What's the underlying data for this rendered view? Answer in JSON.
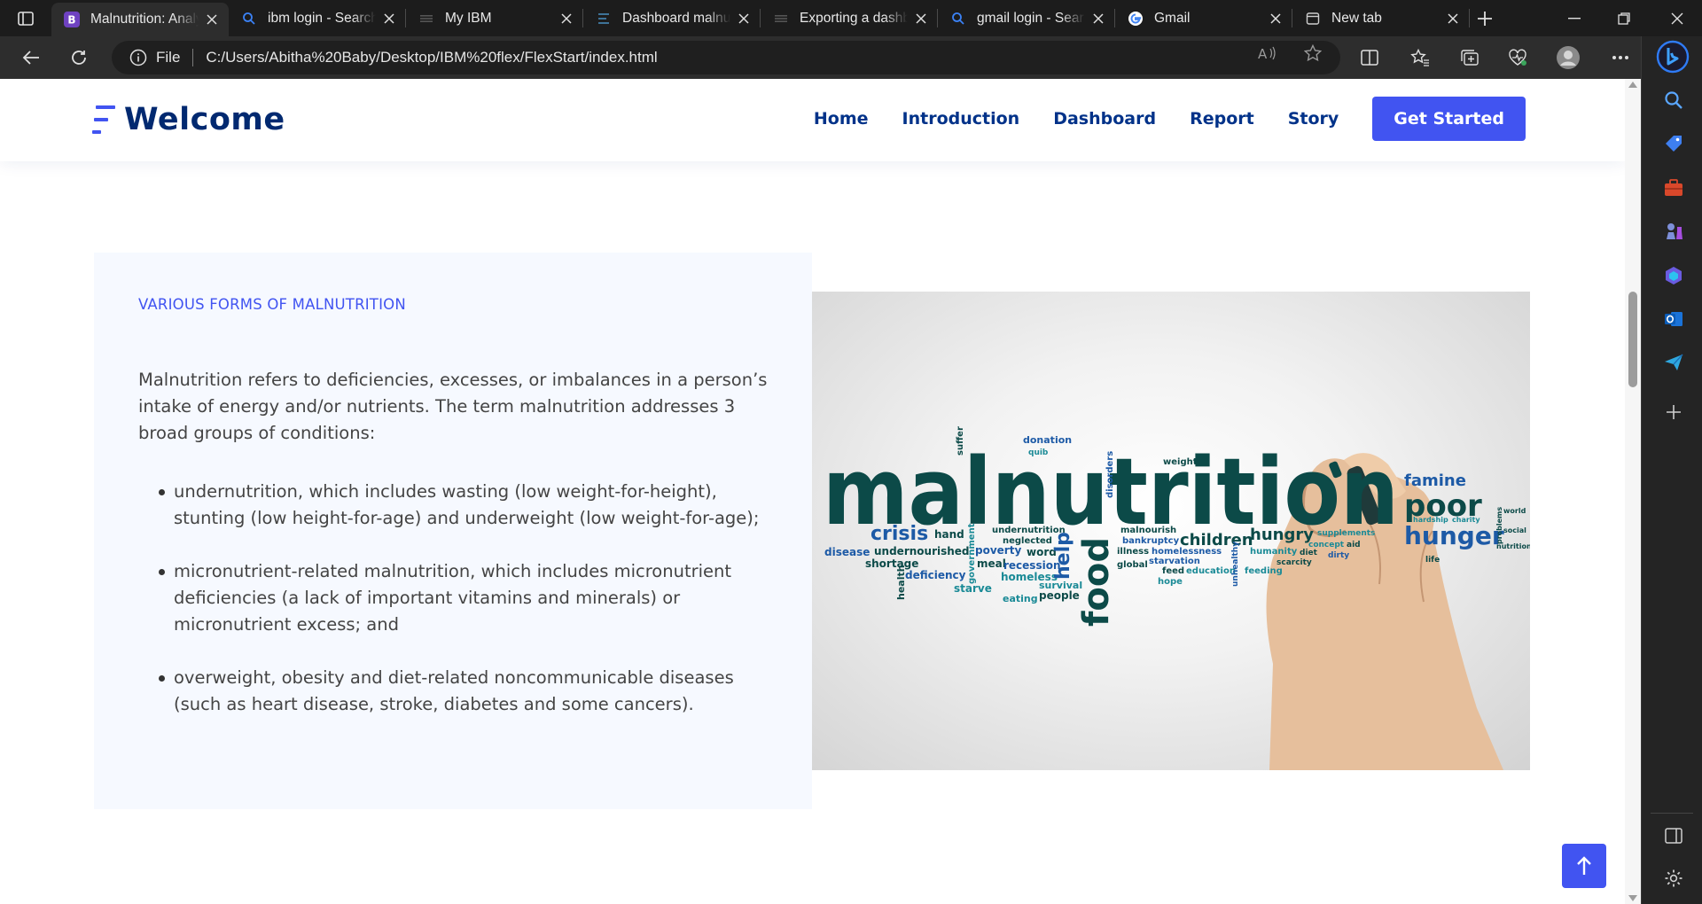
{
  "browser": {
    "tabs": [
      {
        "title": "Malnutrition: Analy",
        "icon": "bootstrap-favicon",
        "active": true
      },
      {
        "title": "ibm login - Search",
        "icon": "search-favicon",
        "active": false
      },
      {
        "title": "My IBM",
        "icon": "ibm-favicon",
        "active": false
      },
      {
        "title": "Dashboard malnu",
        "icon": "dashboard-favicon",
        "active": false
      },
      {
        "title": "Exporting a dashb",
        "icon": "ibm-favicon",
        "active": false
      },
      {
        "title": "gmail login - Sear",
        "icon": "search-favicon",
        "active": false
      },
      {
        "title": "Gmail",
        "icon": "google-favicon",
        "active": false
      },
      {
        "title": "New tab",
        "icon": "newtab-favicon",
        "active": false
      }
    ],
    "address": {
      "scheme_label": "File",
      "url": "C:/Users/Abitha%20Baby/Desktop/IBM%20flex/FlexStart/index.html"
    },
    "colors": {
      "chrome_dark": "#1c1c1c",
      "toolbar": "#2d2d2d"
    }
  },
  "site": {
    "logo_text": "Welcome",
    "nav": {
      "home": "Home",
      "introduction": "Introduction",
      "dashboard": "Dashboard",
      "report": "Report",
      "story": "Story",
      "cta": "Get Started"
    },
    "colors": {
      "primary": "#4154f1",
      "heading": "#012970",
      "nav": "#013289",
      "text": "#444444",
      "panel": "#f6f9ff"
    }
  },
  "section": {
    "subtitle": "VARIOUS FORMS OF MALNUTRITION",
    "intro": "Malnutrition refers to deficiencies, excesses, or imbalances in a person’s intake of energy and/or nutrients. The term malnutrition addresses 3 broad groups of conditions:",
    "bullets": [
      "undernutrition, which includes wasting (low weight-for-height), stunting (low height-for-age) and underweight (low weight-for-age);",
      "micronutrient-related malnutrition, which includes micronutrient deficiencies (a lack of important vitamins and minerals) or micronutrient excess; and",
      "overweight, obesity and diet-related noncommunicable diseases (such as heart disease, stroke, diabetes and some cancers)."
    ]
  },
  "word_cloud": {
    "main": "malnutrition",
    "words": [
      "suffer",
      "donation",
      "quib",
      "weight",
      "disorders",
      "famine",
      "poor",
      "crisis",
      "hand",
      "undernutrition",
      "neglected",
      "malnourish",
      "bankruptcy",
      "children",
      "hungry",
      "supplements",
      "concept",
      "aid",
      "hunger",
      "problems",
      "world",
      "social",
      "nutrition",
      "disease",
      "undernourished",
      "shortage",
      "government",
      "poverty",
      "word",
      "meal",
      "recession",
      "homeless",
      "illness",
      "homelessness",
      "starvation",
      "feed",
      "education",
      "humanity",
      "scarcity",
      "feeding",
      "diet",
      "dirty",
      "life",
      "health",
      "deficiency",
      "starve",
      "eating",
      "people",
      "survival",
      "help",
      "food",
      "global",
      "hope",
      "unhealthy",
      "charity",
      "hardship"
    ],
    "colors": {
      "dark": "#0c4a48",
      "teal": "#1a8a96",
      "blue": "#1d5aa6"
    }
  }
}
